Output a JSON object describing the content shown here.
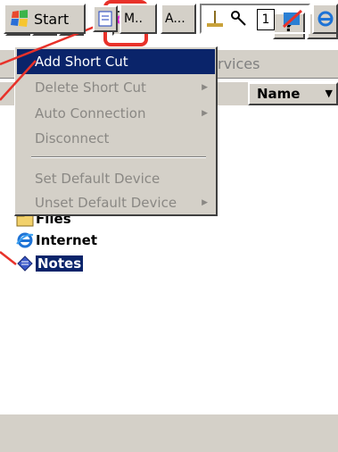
{
  "toolbar": {
    "help_label": "?",
    "close_label": "×"
  },
  "window": {
    "tab_services": "rvices",
    "column_name": "Name",
    "column_arrow": "▼"
  },
  "list": {
    "items": [
      {
        "label": "Files",
        "icon": "folder-icon"
      },
      {
        "label": "Internet",
        "icon": "internet-explorer-icon"
      },
      {
        "label": "Notes",
        "icon": "notes-icon"
      }
    ]
  },
  "menu": {
    "items": [
      {
        "label": "Add Short Cut",
        "state": "active",
        "submenu": false
      },
      {
        "label": "Delete Short Cut",
        "state": "disabled",
        "submenu": true
      },
      {
        "label": "Auto Connection",
        "state": "disabled",
        "submenu": true
      },
      {
        "label": "Disconnect",
        "state": "disabled",
        "submenu": false
      },
      {
        "label": "Set Default Device",
        "state": "disabled",
        "submenu": false
      },
      {
        "label": "Unset Default Device",
        "state": "disabled",
        "submenu": true
      }
    ],
    "submenu_arrow": "▶"
  },
  "taskbar": {
    "start_label": "Start",
    "task_m": "M..",
    "task_a": "A...",
    "tray_number": "1"
  },
  "colors": {
    "highlight": "#0a246a",
    "callout": "#e8322a",
    "chrome": "#d4d0c8"
  }
}
